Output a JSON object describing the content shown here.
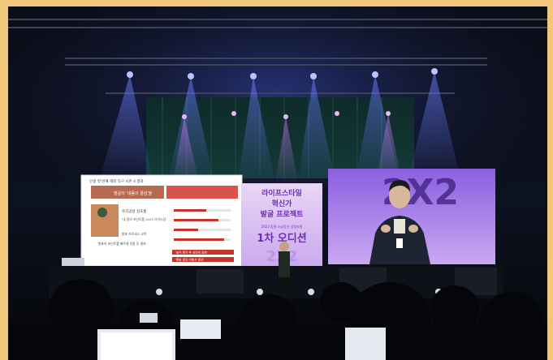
{
  "center_screen": {
    "line1": "라이프스타일",
    "line2": "혁신가",
    "line3": "발굴 프로젝트",
    "line4": "2023 동원 소상공인 성장지원",
    "line5": "1차 오디션"
  },
  "left_slide": {
    "header": "인생 첫 번째 해외 직구 시즌 4 결과",
    "banner": "발굴의 '내몸의 결심'을",
    "name": "조각공방 김초롱",
    "note1": "'내 몸의 포인트를 2023 사이드잡'",
    "note2": "발표 프로세스 교육",
    "quote": "'발표의 포인트를 빠르게 전환 후 결과'",
    "chip1": "'솔직 평가 후 상단에 표현'",
    "chip2": "'활동 결과 비해서 결과'"
  },
  "right_screen": {
    "logo": "2X2"
  },
  "colors": {
    "background_frame": "#f2c87a",
    "screen_purple": "#7a4fd0",
    "slide_red": "#d0342c",
    "stage_light_blue": "#6c7cff"
  }
}
